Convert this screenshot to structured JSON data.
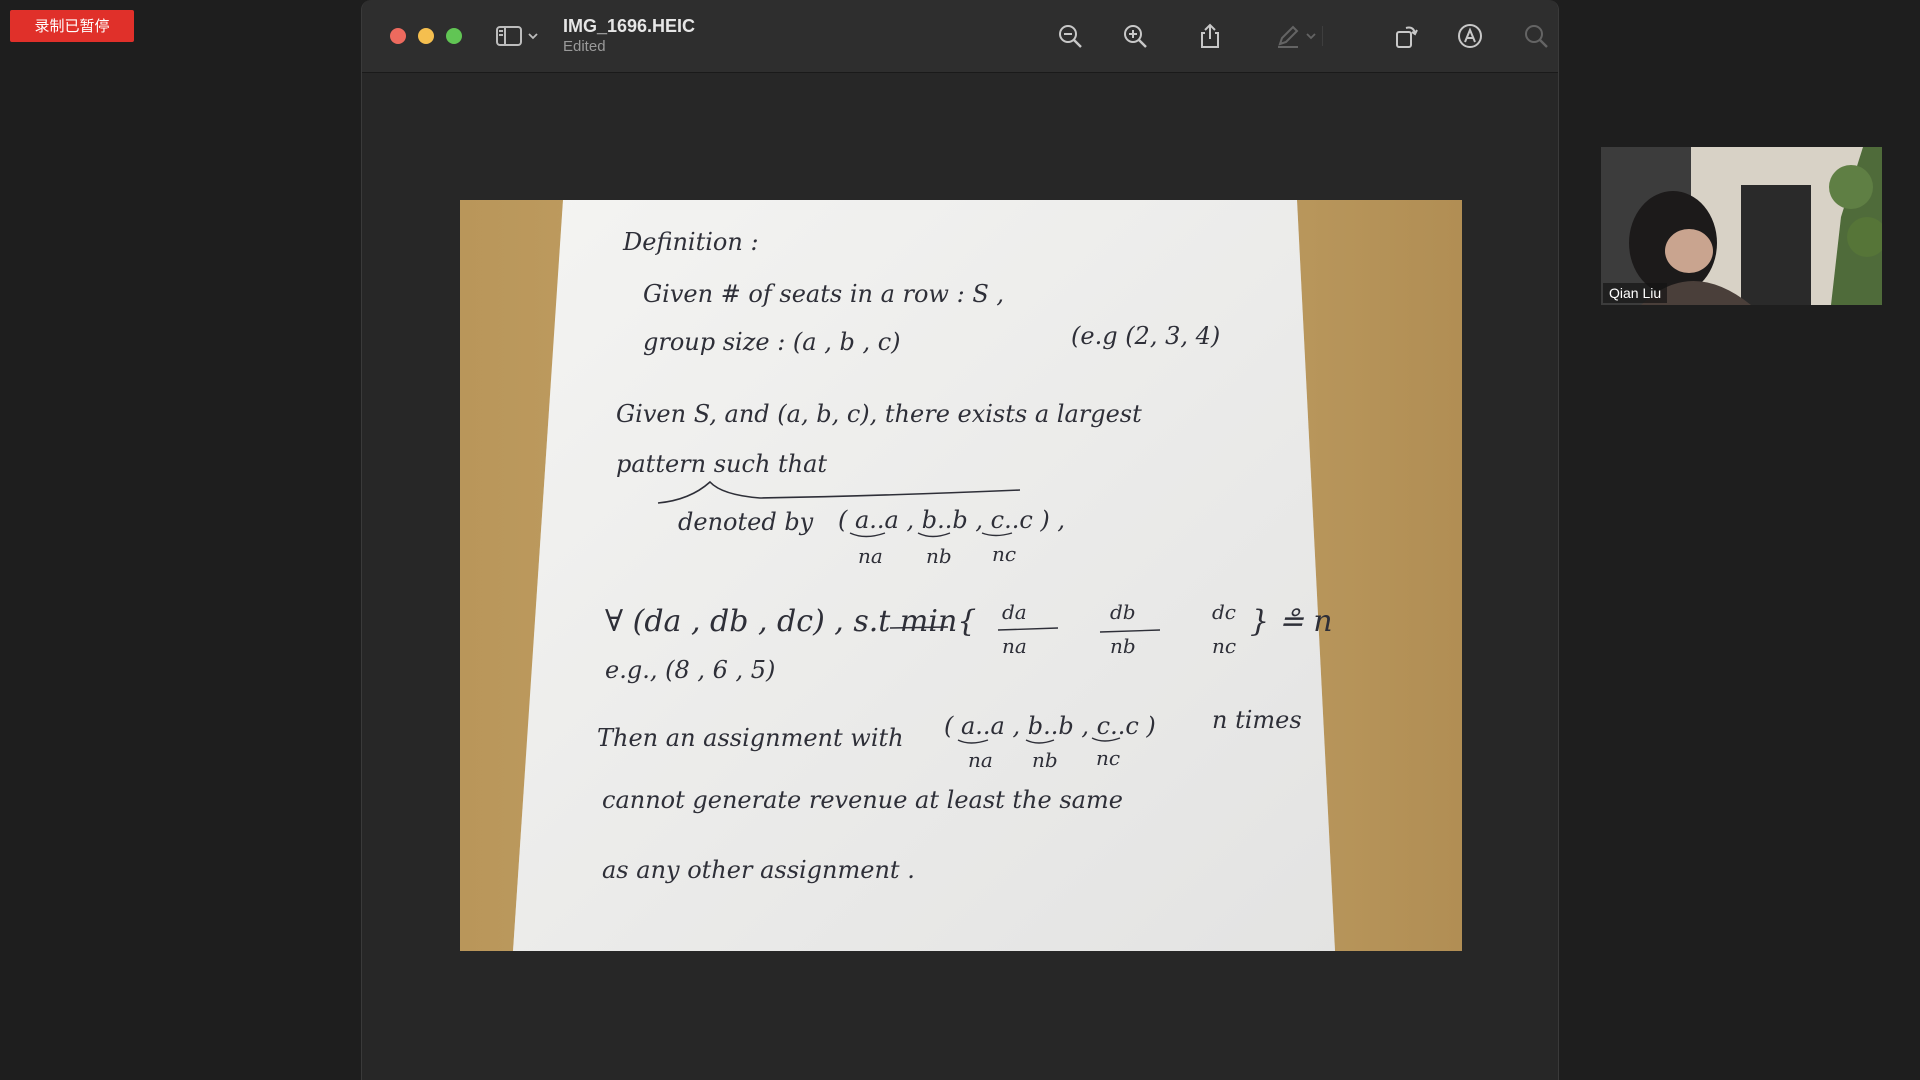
{
  "recording": {
    "label": "录制已暂停",
    "color": "#e0302a"
  },
  "window": {
    "title": "IMG_1696.HEIC",
    "subtitle": "Edited",
    "toolbar": {
      "icons": [
        "sidebar-icon",
        "chevron-down-icon",
        "zoom-out-icon",
        "zoom-in-icon",
        "share-icon",
        "markup-pen-icon",
        "chevron-down-icon",
        "rotate-icon",
        "annotate-icon",
        "search-icon"
      ]
    }
  },
  "document": {
    "lines": [
      "Definition :",
      "Given # of seats in a row : S ,",
      "group size :   (a , b , c)",
      "(e.g (2, 3, 4)",
      "Given S, and (a, b, c), there exists a largest",
      "pattern  such that",
      "denoted by",
      "( a..a , b..b , c..c ) ,",
      "na",
      "nb",
      "nc",
      "∀ (da , db , dc) , s.t  min{",
      "da",
      "na",
      "db",
      "nb",
      "dc",
      "nc",
      "} ≗ n",
      "e.g.,  (8 , 6 , 5)",
      "Then an assignment with",
      "( a..a , b..b , c..c )",
      "n times",
      "na",
      "nb",
      "nc",
      "cannot generate revenue at least the same",
      "as any other assignment ."
    ]
  },
  "participant": {
    "name": "Qian Liu"
  }
}
